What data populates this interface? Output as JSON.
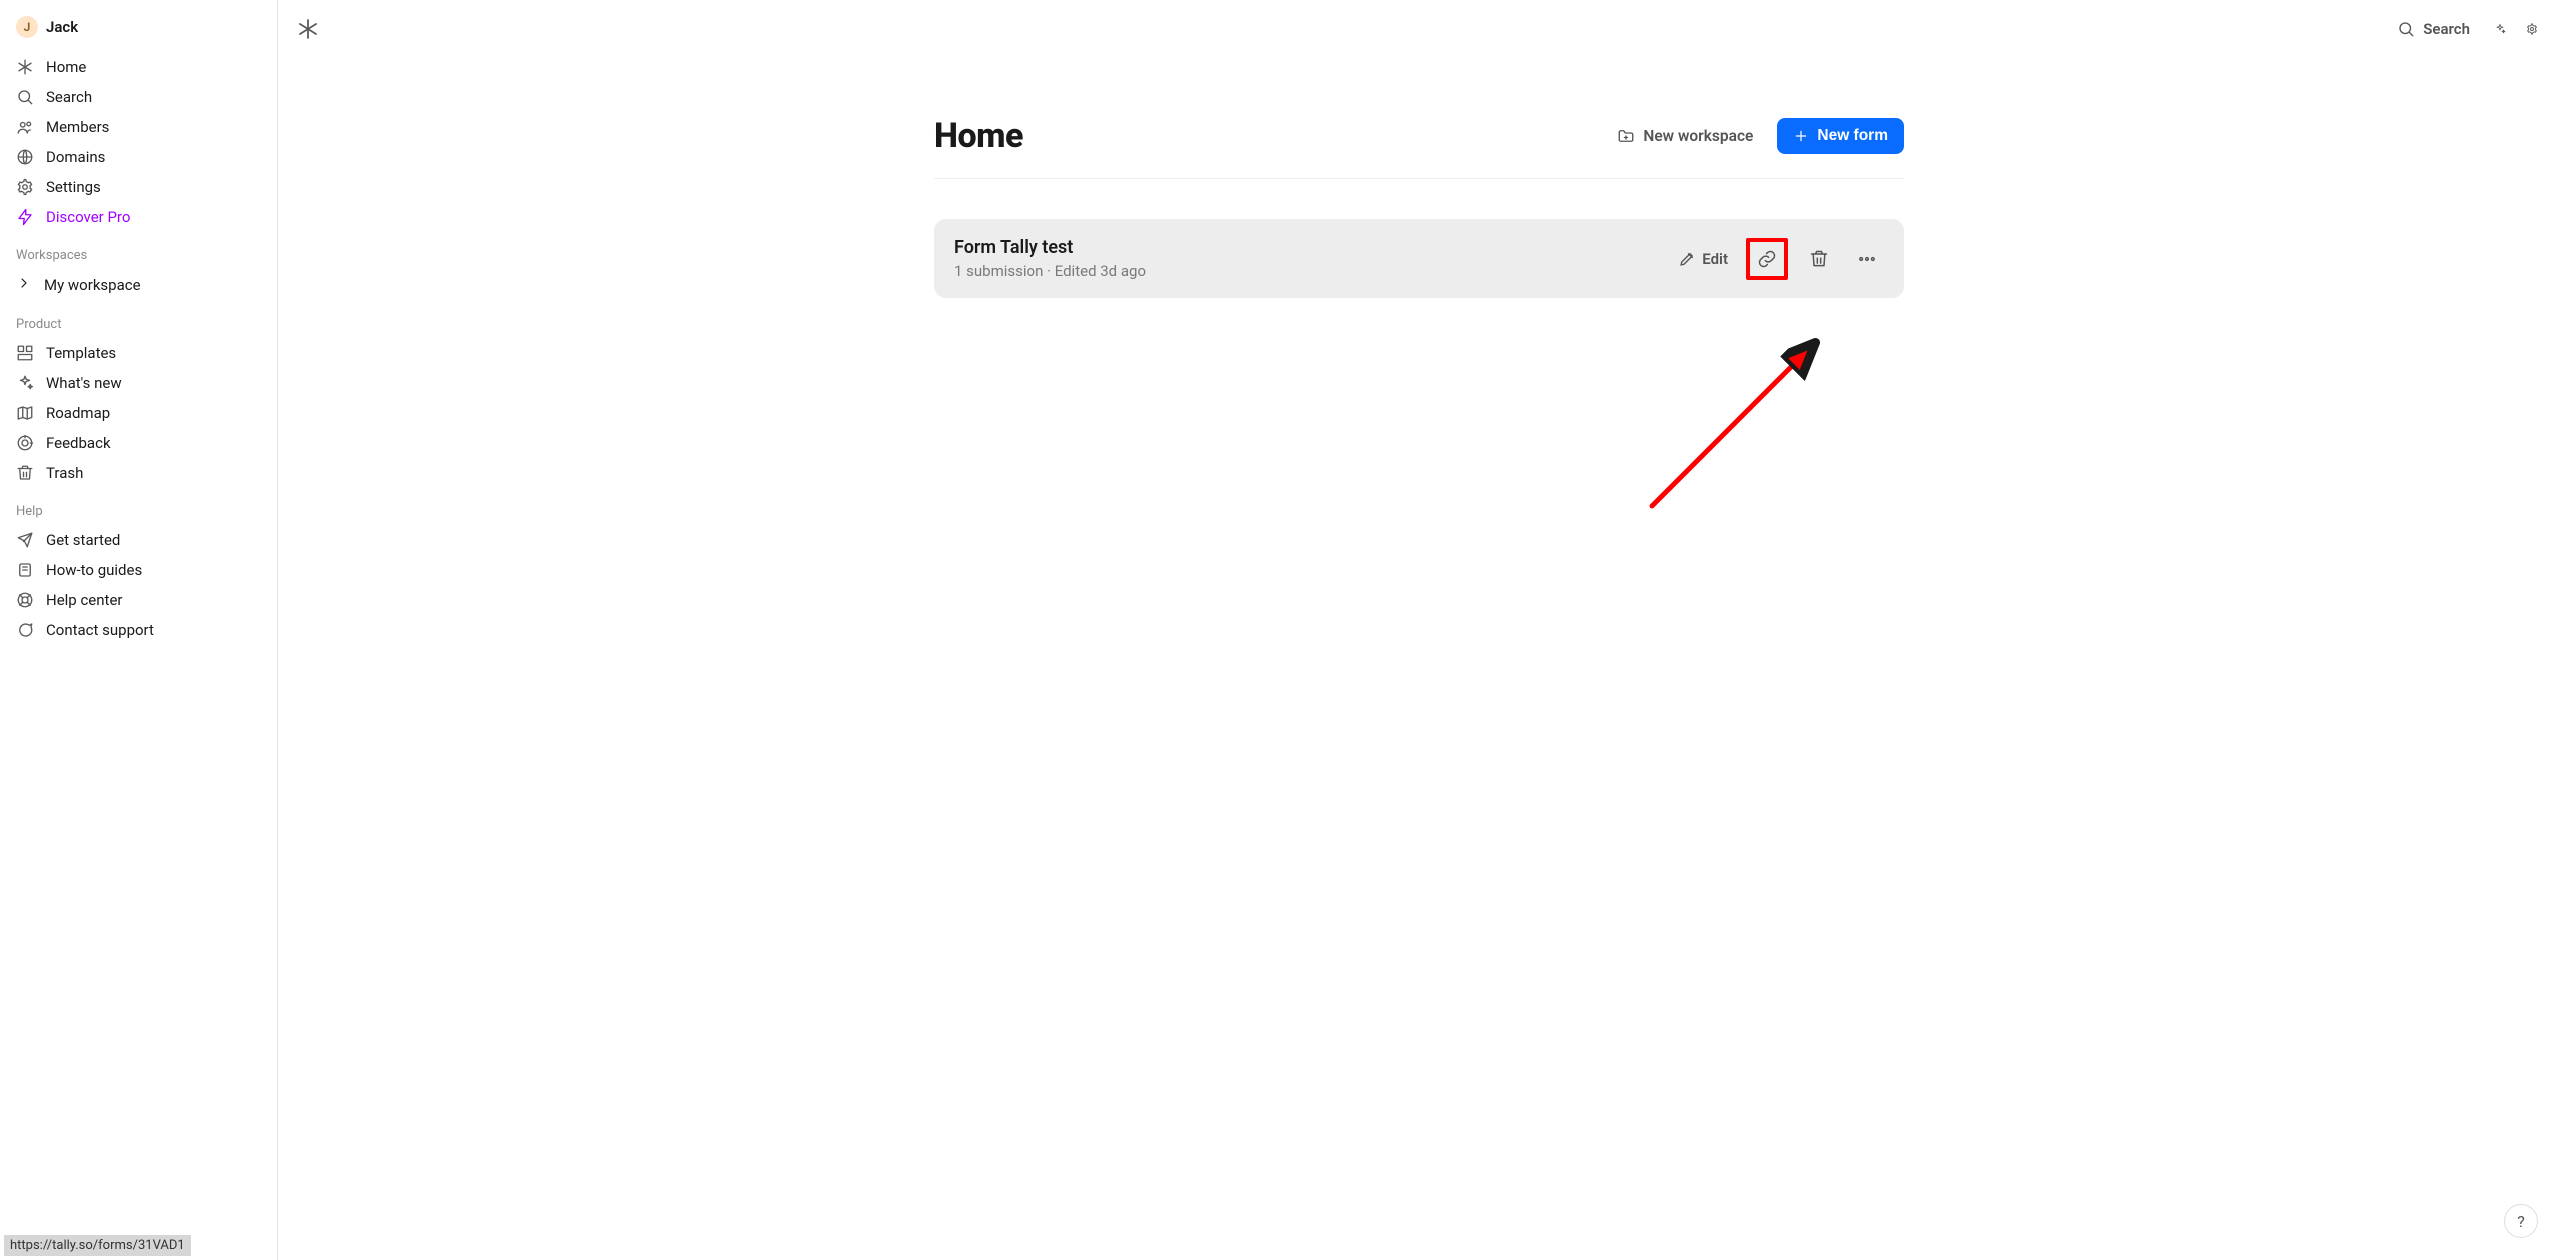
{
  "user": {
    "initial": "J",
    "name": "Jack"
  },
  "nav": {
    "home": "Home",
    "search": "Search",
    "members": "Members",
    "domains": "Domains",
    "settings": "Settings",
    "discover_pro": "Discover Pro"
  },
  "sections": {
    "workspaces_label": "Workspaces",
    "product_label": "Product",
    "help_label": "Help"
  },
  "workspaces": {
    "my_workspace": "My workspace"
  },
  "product": {
    "templates": "Templates",
    "whats_new": "What's new",
    "roadmap": "Roadmap",
    "feedback": "Feedback",
    "trash": "Trash"
  },
  "help": {
    "get_started": "Get started",
    "howto": "How-to guides",
    "help_center": "Help center",
    "contact": "Contact support"
  },
  "footer_url": "https://tally.so/forms/31VAD1",
  "top": {
    "search": "Search"
  },
  "page": {
    "title": "Home",
    "new_workspace": "New workspace",
    "new_form": "New form"
  },
  "form_card": {
    "title": "Form Tally test",
    "subline": "1 submission · Edited 3d ago",
    "edit": "Edit"
  },
  "fab": "?"
}
